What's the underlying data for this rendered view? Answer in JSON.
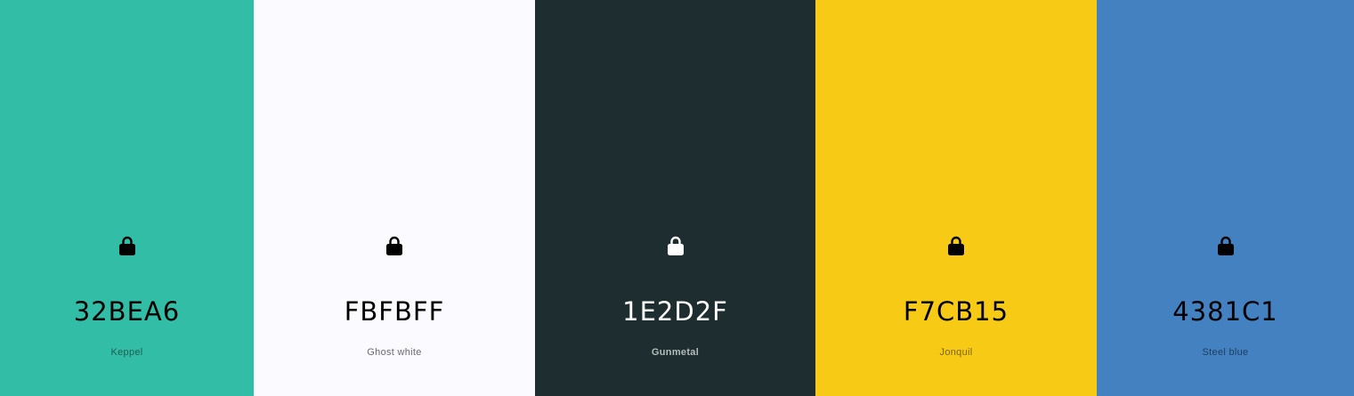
{
  "swatches": [
    {
      "hex": "32BEA6",
      "name": "Keppel",
      "background": "#32BEA6",
      "text_color": "#000000",
      "name_color": "#1f5e52",
      "lock_color": "#000000",
      "icon": "lock-icon"
    },
    {
      "hex": "FBFBFF",
      "name": "Ghost white",
      "background": "#FBFBFF",
      "text_color": "#000000",
      "name_color": "#6a6a70",
      "lock_color": "#000000",
      "icon": "lock-icon"
    },
    {
      "hex": "1E2D2F",
      "name": "Gunmetal",
      "background": "#1E2D2F",
      "text_color": "#FFFFFF",
      "name_color": "#b5bcbd",
      "lock_color": "#FFFFFF",
      "icon": "lock-icon"
    },
    {
      "hex": "F7CB15",
      "name": "Jonquil",
      "background": "#F7CB15",
      "text_color": "#000000",
      "name_color": "#7a6410",
      "lock_color": "#000000",
      "icon": "lock-icon"
    },
    {
      "hex": "4381C1",
      "name": "Steel blue",
      "background": "#4381C1",
      "text_color": "#000000",
      "name_color": "#1f3d5e",
      "lock_color": "#000000",
      "icon": "lock-icon"
    }
  ]
}
